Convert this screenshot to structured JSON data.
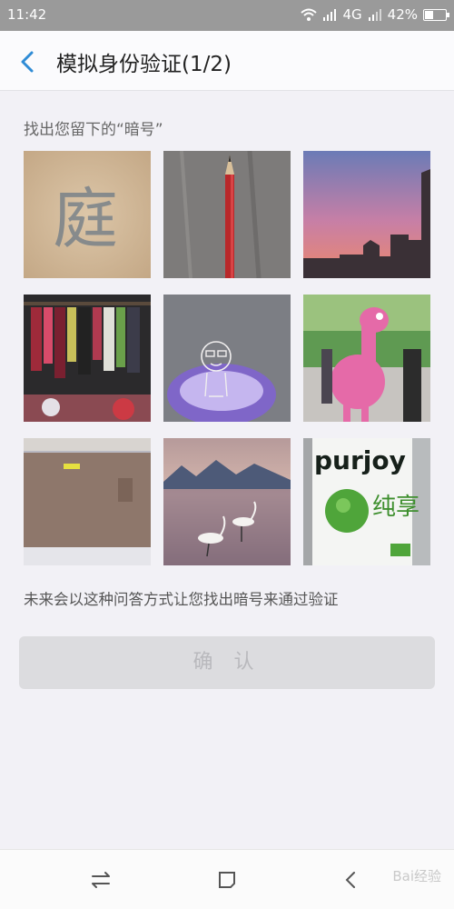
{
  "status": {
    "time": "11:42",
    "network": "4G",
    "battery": "42%",
    "battery_level": 0.42
  },
  "header": {
    "title": "模拟身份验证(1/2)",
    "back_icon": "chevron-left-icon",
    "accent": "#2f8cd6"
  },
  "instruction": "找出您留下的“暗号”",
  "images": [
    {
      "label": "庭"
    },
    {
      "label": "pencil"
    },
    {
      "label": "sunset-skyline"
    },
    {
      "label": "clothes-rack"
    },
    {
      "label": "glass-cup"
    },
    {
      "label": "pink-flamingo-mascot"
    },
    {
      "label": "mattress"
    },
    {
      "label": "cranes-on-lake"
    },
    {
      "label": "purjoy",
      "brand": "purjoy",
      "brand_cn": "纯享"
    }
  ],
  "hint": "未来会以这种问答方式让您找出暗号来通过验证",
  "confirm_label": "确 认",
  "nav": {
    "icons": [
      "menu-icon",
      "home-icon",
      "back-icon"
    ],
    "watermark": "Bai经验"
  }
}
